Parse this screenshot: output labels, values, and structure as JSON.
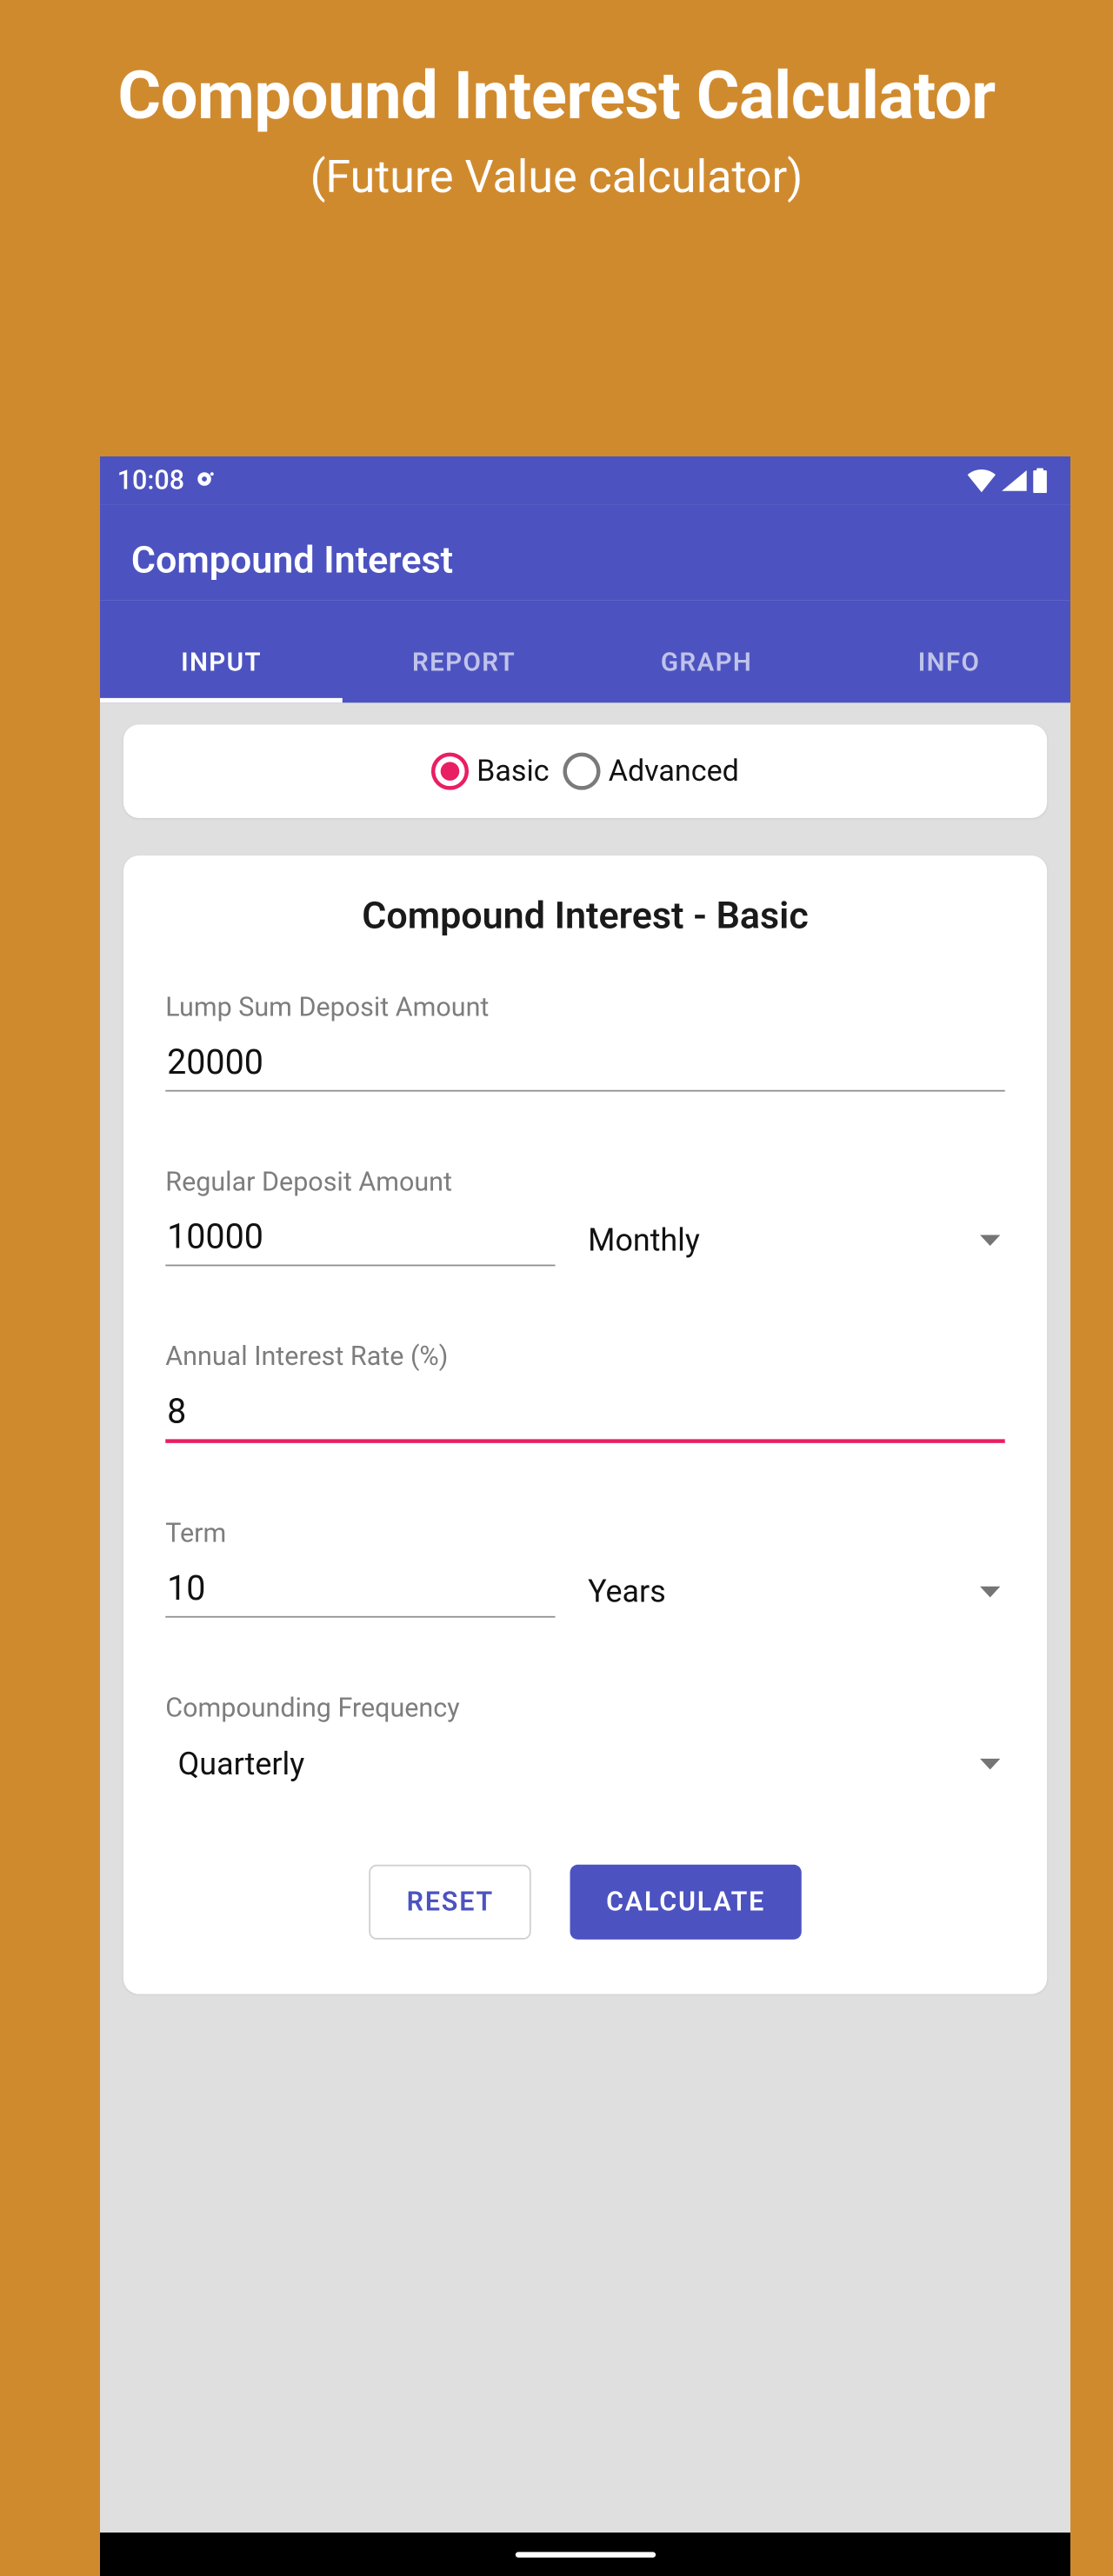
{
  "page": {
    "title": "Compound Interest Calculator",
    "subtitle": "(Future Value calculator)"
  },
  "status": {
    "time": "10:08"
  },
  "app": {
    "title": "Compound Interest"
  },
  "tabs": {
    "input": "INPUT",
    "report": "REPORT",
    "graph": "GRAPH",
    "info": "INFO"
  },
  "mode": {
    "basic": "Basic",
    "advanced": "Advanced"
  },
  "form": {
    "title": "Compound Interest - Basic",
    "lump_sum": {
      "label": "Lump Sum Deposit Amount",
      "value": "20000"
    },
    "regular": {
      "label": "Regular Deposit Amount",
      "value": "10000",
      "freq": "Monthly"
    },
    "rate": {
      "label": "Annual Interest Rate (%)",
      "value": "8"
    },
    "term": {
      "label": "Term",
      "value": "10",
      "unit": "Years"
    },
    "compounding": {
      "label": "Compounding Frequency",
      "value": "Quarterly"
    }
  },
  "buttons": {
    "reset": "RESET",
    "calculate": "CALCULATE"
  }
}
